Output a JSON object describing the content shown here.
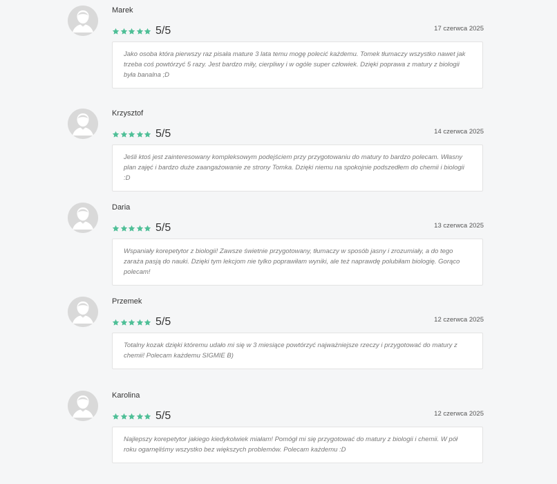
{
  "colors": {
    "star": "#4fbf97",
    "avatar": "#d9d9d9",
    "background": "#f5f6f7"
  },
  "icons": {
    "avatar": "user-avatar-icon",
    "star": "star-icon"
  },
  "reviews": [
    {
      "name": "Marek",
      "rating_value": 5,
      "rating": "5/5",
      "date": "17 czerwca 2025",
      "text": "Jako osoba która pierwszy raz pisała mature 3 lata temu mogę polecić każdemu. Tomek tłumaczy wszystko nawet jak trzeba coś powtórzyć 5 razy. Jest bardzo miły, cierpliwy i w ogóle super człowiek. Dzięki poprawa z matury z biologii była banalna ;D"
    },
    {
      "name": "Krzysztof",
      "rating_value": 5,
      "rating": "5/5",
      "date": "14 czerwca 2025",
      "text": "Jeśli ktoś jest zainteresowany kompleksowym podejściem przy przygotowaniu do matury to bardzo polecam. Własny plan zajęć i bardzo duże zaangażowanie ze strony Tomka. Dzięki niemu na spokojnie podszedłem do chemii i biologii :D"
    },
    {
      "name": "Daria",
      "rating_value": 5,
      "rating": "5/5",
      "date": "13 czerwca 2025",
      "text": "Wspaniały korepetytor z biologii! Zawsze świetnie przygotowany, tłumaczy w sposób jasny i zrozumiały, a do tego zaraża pasją do nauki. Dzięki tym lekcjom nie tylko poprawiłam wyniki, ale też naprawdę polubiłam biologię. Gorąco polecam!"
    },
    {
      "name": "Przemek",
      "rating_value": 5,
      "rating": "5/5",
      "date": "12 czerwca 2025",
      "text": "Totalny kozak dzięki któremu udało mi się w 3 miesiące powtórzyć najważniejsze rzeczy i przygotować do matury z chemii! Polecam każdemu SIGMIE B)"
    },
    {
      "name": "Karolina",
      "rating_value": 5,
      "rating": "5/5",
      "date": "12 czerwca 2025",
      "text": "Najlepszy korepetytor jakiego kiedykolwiek miałam! Pomógł mi się przygotować do matury z biologii i chemii. W pół roku ogarnęliśmy wszystko bez większych problemów. Polecam każdemu :D"
    }
  ]
}
